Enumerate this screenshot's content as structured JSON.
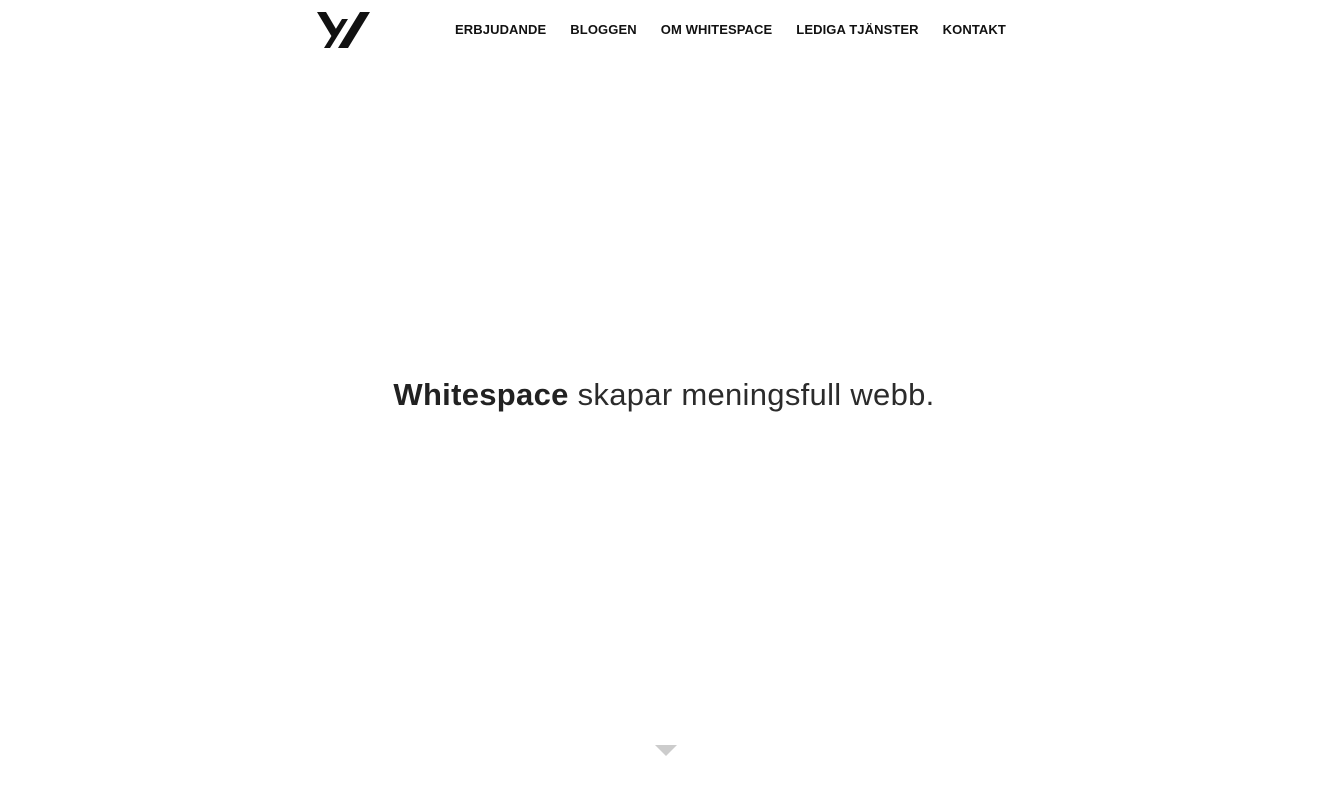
{
  "header": {
    "logo_icon": "whitespace-logo-icon",
    "nav": [
      {
        "label": "ERBJUDANDE"
      },
      {
        "label": "BLOGGEN"
      },
      {
        "label": "OM WHITESPACE"
      },
      {
        "label": "LEDIGA TJÄNSTER"
      },
      {
        "label": "KONTAKT"
      }
    ]
  },
  "hero": {
    "brand": "Whitespace",
    "tagline": "skapar meningsfull webb."
  },
  "scroll_indicator": {
    "icon": "chevron-down-icon",
    "color": "#cccccc"
  },
  "colors": {
    "text": "#222222",
    "background": "#ffffff"
  }
}
